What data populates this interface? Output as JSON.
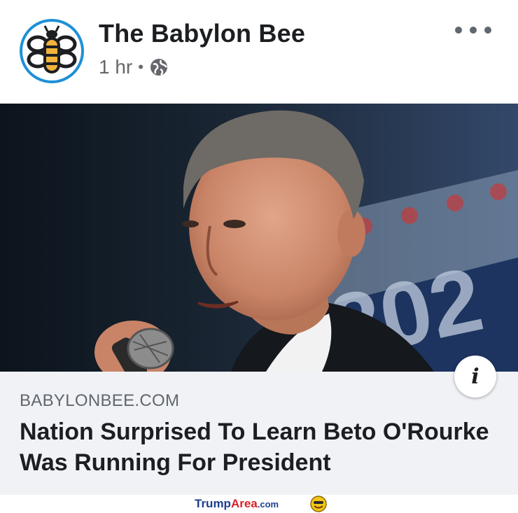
{
  "post": {
    "page_name": "The Babylon Bee",
    "time": "1 hr",
    "separator": "•",
    "privacy_icon": "globe-icon",
    "more_icon": "more-options-icon"
  },
  "link_preview": {
    "image_caption_text": "202",
    "info_label": "i",
    "domain": "BABYLONBEE.COM",
    "headline": "Nation Surprised To Learn Beto O'Rourke Was Running For President"
  },
  "watermark": {
    "trump": "Trump",
    "area": "Area",
    "com": ".com",
    "icon": "smiley-icon"
  },
  "colors": {
    "avatar_ring": "#1e90d6",
    "bee_yellow": "#f2b33d",
    "link_card_bg": "#f0f2f5",
    "watermark_blue": "#1f3f8f",
    "watermark_red": "#d9232a"
  }
}
